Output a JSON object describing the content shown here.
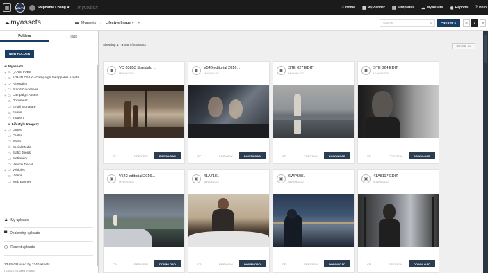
{
  "topbar": {
    "grid_icon": "apps-grid-icon",
    "logo_text": "VOLVO",
    "user": "Stephanie Chang",
    "brand": "myvolbox",
    "nav": [
      {
        "icon": "home-icon",
        "label": "Home"
      },
      {
        "icon": "planner-icon",
        "label": "MyPlanner"
      },
      {
        "icon": "templates-icon",
        "label": "Templates"
      },
      {
        "icon": "assets-icon",
        "label": "MyAssets"
      },
      {
        "icon": "reports-icon",
        "label": "Reports"
      },
      {
        "icon": "help-icon",
        "label": "Help"
      }
    ]
  },
  "subbar": {
    "brand": "myassets",
    "breadcrumb": [
      "Myassets",
      "Lifestyle Imagery"
    ],
    "search_placeholder": "Search...",
    "create_label": "CREATE ▾"
  },
  "sidebar": {
    "tabs": [
      "Folders",
      "Tags"
    ],
    "new_folder": "NEW FOLDER",
    "tree": [
      {
        "label": "Myassets",
        "root": true,
        "expand": ""
      },
      {
        "label": "_ARCHIVES",
        "expand": "+"
      },
      {
        "label": "ADMIN ONLY - Campaign Swappable Assets",
        "expand": "+"
      },
      {
        "label": "Aftersales",
        "expand": "+"
      },
      {
        "label": "Brand Guidelines",
        "expand": "+"
      },
      {
        "label": "Campaign Assets",
        "expand": "+"
      },
      {
        "label": "Document",
        "expand": ""
      },
      {
        "label": "Email Signature",
        "expand": ""
      },
      {
        "label": "Forms",
        "expand": ""
      },
      {
        "label": "Imagery",
        "expand": ""
      },
      {
        "label": "Lifestyle Imagery",
        "expand": "",
        "selected": true
      },
      {
        "label": "Logos",
        "expand": "+"
      },
      {
        "label": "Poster",
        "expand": ""
      },
      {
        "label": "Radio",
        "expand": ""
      },
      {
        "label": "Social Media",
        "expand": ""
      },
      {
        "label": "Static Jpegs",
        "expand": ""
      },
      {
        "label": "Stationary",
        "expand": ""
      },
      {
        "label": "Vehicle Decal",
        "expand": ""
      },
      {
        "label": "Vehicles",
        "expand": "+"
      },
      {
        "label": "Videos",
        "expand": ""
      },
      {
        "label": "Web Banner",
        "expand": ""
      }
    ],
    "my_uploads": "My uploads",
    "dealership_uploads": "Dealership uploads",
    "recent_uploads": "Recent uploads",
    "usage": "23.65 GB used by 1240 assets",
    "usage_sub": "(100.03 GB used in total)"
  },
  "main": {
    "showing_prefix": "Showing ",
    "showing_range": "1 - 8",
    "showing_suffix": " out of 8 assets",
    "display_label": "⊞ DISPLAY",
    "cards": [
      {
        "title": "VO 03853 Standalo ...",
        "id": "MVA961423"
      },
      {
        "title": "V543 editorial 2016...",
        "id": "MVA961428"
      },
      {
        "title": "STE 027 EDIT",
        "id": "MVA961427"
      },
      {
        "title": "STE 024 EDIT",
        "id": "MVA961426"
      },
      {
        "title": "V543 editorial 2016...",
        "id": "MVA961425"
      },
      {
        "title": "41A7131",
        "id": "MVA961424"
      },
      {
        "title": "6WP5081",
        "id": "MVA961422"
      },
      {
        "title": "41A8117 EDIT",
        "id": "MVA961422"
      }
    ],
    "actions": {
      "copy": "CP",
      "preview": "PREVIEW",
      "download": "DOWNLOAD"
    }
  }
}
